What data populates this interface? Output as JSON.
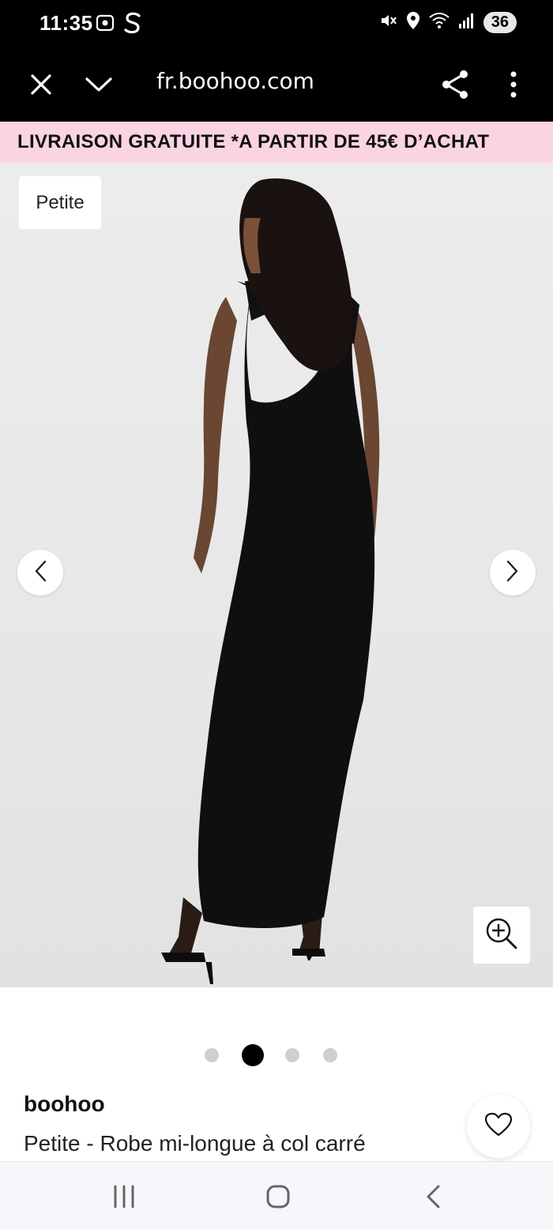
{
  "status_bar": {
    "time": "11:35",
    "battery": "36",
    "icons": [
      "screenshot-icon",
      "s-app-icon",
      "mute-icon",
      "location-icon",
      "wifi-icon",
      "signal-icon"
    ]
  },
  "browser": {
    "url": "fr.boohoo.com",
    "icons": [
      "close-icon",
      "chevron-down-icon",
      "share-icon",
      "more-vertical-icon"
    ]
  },
  "promo": {
    "text": "LIVRAISON GRATUITE  *A PARTIR DE 45€ D’ACHAT",
    "background": "#fbd4e4"
  },
  "gallery": {
    "badge": "Petite",
    "current_index": 2,
    "total": 4,
    "icons": [
      "chevron-left-icon",
      "chevron-right-icon",
      "zoom-in-icon"
    ]
  },
  "product": {
    "brand": "boohoo",
    "title": "Petite - Robe mi-longue à col carré"
  },
  "android_nav": {
    "icons": [
      "recents-icon",
      "home-icon",
      "back-icon"
    ]
  }
}
